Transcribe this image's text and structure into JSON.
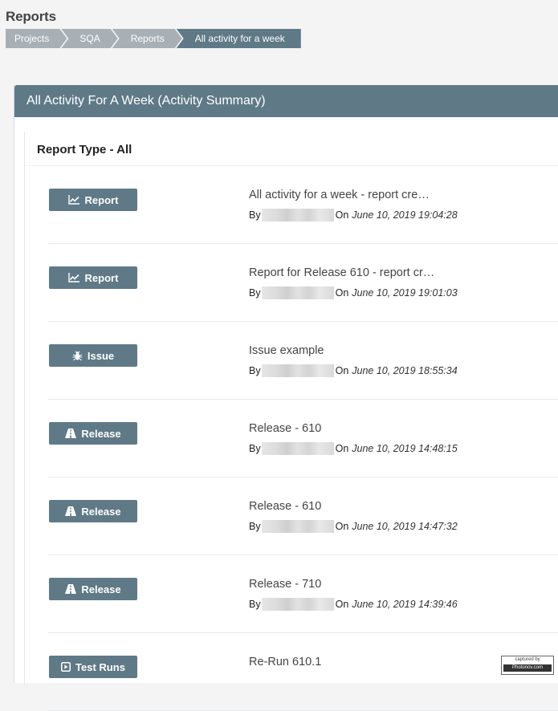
{
  "page": {
    "title": "Reports"
  },
  "breadcrumb": [
    "Projects",
    "SQA",
    "Reports",
    "All activity for a week"
  ],
  "panel": {
    "title": "All Activity For A Week (Activity Summary)",
    "report_type": "Report Type - All"
  },
  "activities": [
    {
      "type": "Report",
      "icon": "chart-icon",
      "title": "All activity for a week - report cre…",
      "by": "By",
      "on": "On",
      "date": "June 10, 2019 19:04:28"
    },
    {
      "type": "Report",
      "icon": "chart-icon",
      "title": "Report for Release 610 - report cr…",
      "by": "By",
      "on": "On",
      "date": "June 10, 2019 19:01:03"
    },
    {
      "type": "Issue",
      "icon": "bug-icon",
      "title": "Issue example",
      "by": "By",
      "on": "On",
      "date": "June 10, 2019 18:55:34"
    },
    {
      "type": "Release",
      "icon": "road-icon",
      "title": "Release - 610",
      "by": "By",
      "on": "On",
      "date": "June 10, 2019 14:48:15"
    },
    {
      "type": "Release",
      "icon": "road-icon",
      "title": "Release - 610",
      "by": "By",
      "on": "On",
      "date": "June 10, 2019 14:47:32"
    },
    {
      "type": "Release",
      "icon": "road-icon",
      "title": "Release - 710",
      "by": "By",
      "on": "On",
      "date": "June 10, 2019 14:39:46"
    },
    {
      "type": "Test Runs",
      "icon": "play-icon",
      "title": "Re-Run 610.1",
      "by": "",
      "on": "",
      "date": ""
    }
  ],
  "watermark": {
    "line1": "captured by",
    "line2": "Photonov.com"
  },
  "colors": {
    "accent": "#5f7987",
    "breadcrumb": "#a9b0b5"
  }
}
